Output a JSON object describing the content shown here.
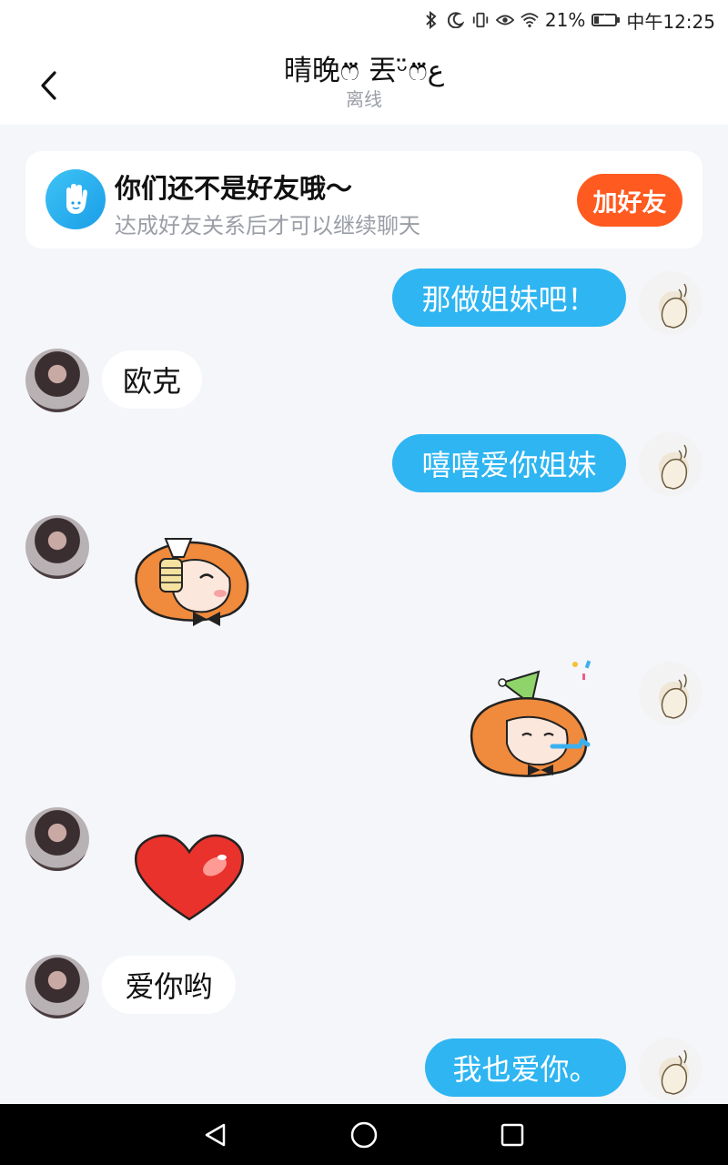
{
  "status_bar": {
    "battery_percent": "21%",
    "time": "中午12:25",
    "battery_level": 0.21,
    "icons": [
      "bluetooth-icon",
      "moon-icon",
      "vibrate-icon",
      "eye-icon",
      "wifi-icon",
      "battery-icon"
    ]
  },
  "header": {
    "title": "晴晚ෆ⃛ 丟ᵕ̈ෆ⃛ع",
    "subtitle": "离线"
  },
  "friend_notice": {
    "title": "你们还不是好友哦～",
    "subtitle": "达成好友关系后才可以继续聊天",
    "add_button": "加好友"
  },
  "messages": [
    {
      "direction": "out",
      "type": "text",
      "text": "那做姐妹吧！"
    },
    {
      "direction": "in",
      "type": "text",
      "text": "欧克"
    },
    {
      "direction": "out",
      "type": "text",
      "text": "嘻嘻爱你姐妹"
    },
    {
      "direction": "in",
      "type": "sticker",
      "sticker": "cheers-sticker"
    },
    {
      "direction": "out",
      "type": "sticker",
      "sticker": "party-sticker"
    },
    {
      "direction": "in",
      "type": "sticker",
      "sticker": "heart-sticker"
    },
    {
      "direction": "in",
      "type": "text",
      "text": "爱你哟"
    },
    {
      "direction": "out",
      "type": "text",
      "text": "我也爱你。"
    }
  ],
  "colors": {
    "accent_blue": "#2eb5f2",
    "add_button": "#ff5a1f",
    "background": "#f4f6f9"
  }
}
